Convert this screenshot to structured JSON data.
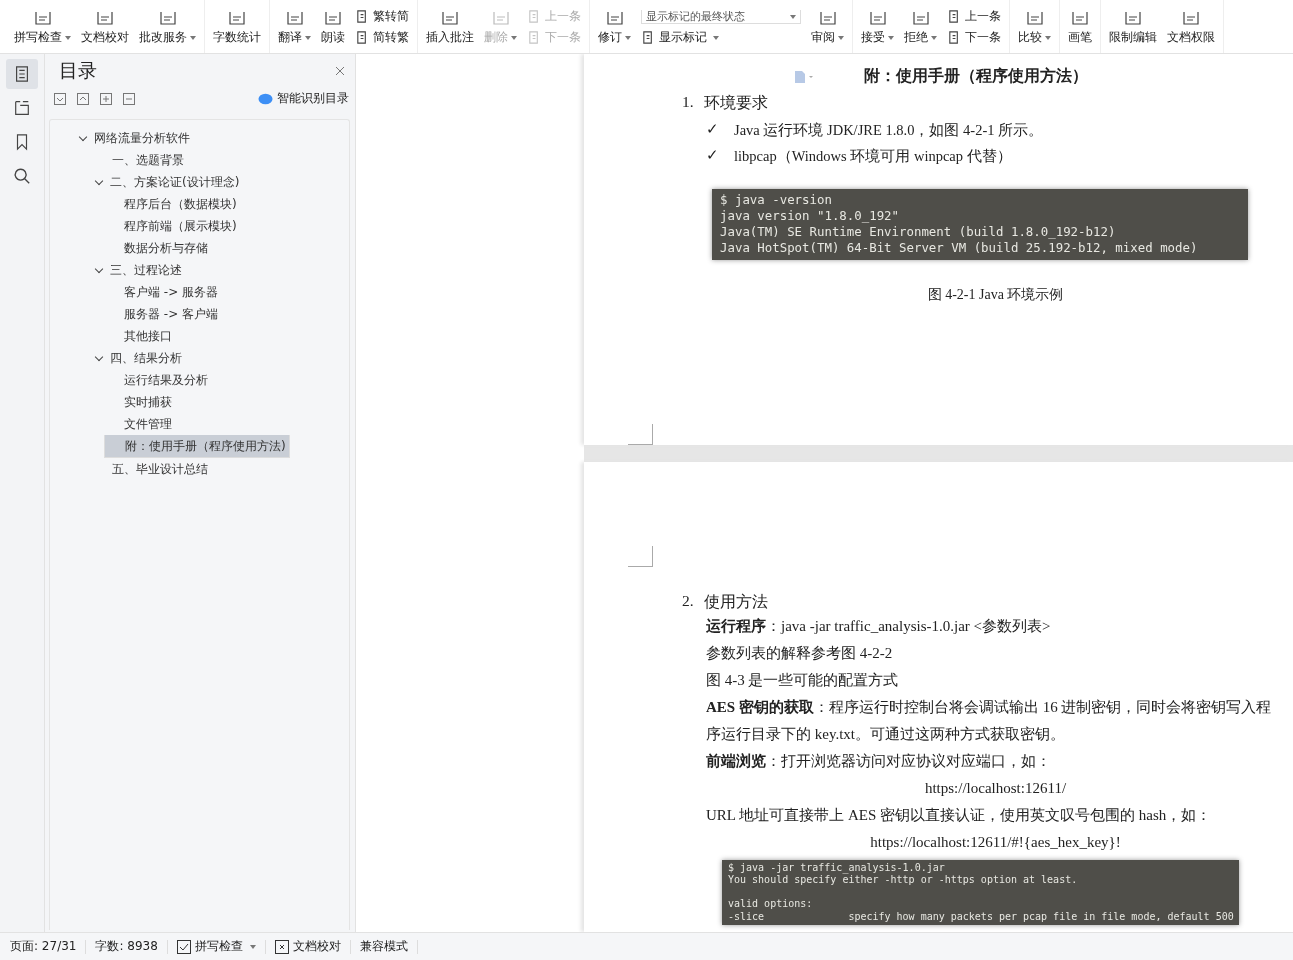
{
  "toolbar": {
    "groups": [
      {
        "items": [
          {
            "kind": "big",
            "label": "拼写检查",
            "dropdown": true,
            "disabled": false
          },
          {
            "kind": "big",
            "label": "文档校对",
            "dropdown": false,
            "disabled": false
          },
          {
            "kind": "big",
            "label": "批改服务",
            "dropdown": true,
            "disabled": false
          }
        ]
      },
      {
        "items": [
          {
            "kind": "big",
            "label": "字数统计",
            "dropdown": false,
            "disabled": false
          }
        ]
      },
      {
        "items": [
          {
            "kind": "big",
            "label": "翻译",
            "dropdown": true,
            "disabled": false
          },
          {
            "kind": "big",
            "label": "朗读",
            "dropdown": false,
            "disabled": false
          },
          {
            "kind": "stack",
            "items": [
              {
                "kind": "small",
                "label": "繁转简",
                "dropdown": false,
                "disabled": false
              },
              {
                "kind": "small",
                "label": "简转繁",
                "dropdown": false,
                "disabled": false
              }
            ]
          }
        ]
      },
      {
        "items": [
          {
            "kind": "big",
            "label": "插入批注",
            "dropdown": false,
            "disabled": false
          },
          {
            "kind": "big",
            "label": "删除",
            "dropdown": true,
            "disabled": true
          },
          {
            "kind": "stack",
            "items": [
              {
                "kind": "small",
                "label": "上一条",
                "dropdown": false,
                "disabled": true
              },
              {
                "kind": "small",
                "label": "下一条",
                "dropdown": false,
                "disabled": true
              }
            ]
          }
        ]
      },
      {
        "items": [
          {
            "kind": "big",
            "label": "修订",
            "dropdown": true,
            "disabled": false
          },
          {
            "kind": "stack",
            "items": [
              {
                "kind": "select",
                "label": "显示标记的最终状态"
              },
              {
                "kind": "small",
                "label": "显示标记",
                "dropdown": true,
                "disabled": false
              }
            ]
          },
          {
            "kind": "big",
            "label": "审阅",
            "dropdown": true,
            "disabled": false
          }
        ]
      },
      {
        "items": [
          {
            "kind": "big",
            "label": "接受",
            "dropdown": true,
            "disabled": false
          },
          {
            "kind": "big",
            "label": "拒绝",
            "dropdown": true,
            "disabled": false
          },
          {
            "kind": "stack",
            "items": [
              {
                "kind": "small",
                "label": "上一条",
                "dropdown": false,
                "disabled": false
              },
              {
                "kind": "small",
                "label": "下一条",
                "dropdown": false,
                "disabled": false
              }
            ]
          }
        ]
      },
      {
        "items": [
          {
            "kind": "big",
            "label": "比较",
            "dropdown": true,
            "disabled": false
          }
        ]
      },
      {
        "items": [
          {
            "kind": "big",
            "label": "画笔",
            "dropdown": false,
            "disabled": false
          }
        ]
      },
      {
        "items": [
          {
            "kind": "big",
            "label": "限制编辑",
            "dropdown": false,
            "disabled": false
          },
          {
            "kind": "big",
            "label": "文档权限",
            "dropdown": false,
            "disabled": false
          }
        ]
      }
    ]
  },
  "rail": [
    {
      "selected": true
    },
    {
      "selected": false
    },
    {
      "selected": false
    },
    {
      "selected": false
    }
  ],
  "nav_panel": {
    "title": "目录",
    "smart_button": "智能识别目录",
    "tree": [
      {
        "label": "网络流量分析软件",
        "expanded": true,
        "selected": false,
        "children": [
          {
            "label": "一、选题背景",
            "selected": false
          },
          {
            "label": "二、方案论证(设计理念)",
            "expanded": true,
            "selected": false,
            "children": [
              {
                "label": "程序后台（数据模块)",
                "selected": false
              },
              {
                "label": "程序前端（展示模块)",
                "selected": false
              },
              {
                "label": "数据分析与存储",
                "selected": false
              }
            ]
          },
          {
            "label": "三、过程论述",
            "expanded": true,
            "selected": false,
            "children": [
              {
                "label": "客户端 -> 服务器",
                "selected": false
              },
              {
                "label": "服务器 -> 客户端",
                "selected": false
              },
              {
                "label": "其他接口",
                "selected": false
              }
            ]
          },
          {
            "label": "四、结果分析",
            "expanded": true,
            "selected": false,
            "children": [
              {
                "label": "运行结果及分析",
                "selected": false
              },
              {
                "label": "实时捕获",
                "selected": false
              },
              {
                "label": "文件管理",
                "selected": false
              },
              {
                "label": "附：使用手册（程序使用方法)",
                "selected": true
              }
            ]
          },
          {
            "label": "五、毕业设计总结",
            "selected": false
          }
        ]
      }
    ]
  },
  "document": {
    "page_1": {
      "heading": "附：使用手册（程序使用方法）",
      "section_number": "1.",
      "section_title": "环境要求",
      "checklist": [
        {
          "mark": "✓",
          "text": "Java 运行环境  JDK/JRE 1.8.0，如图  4-2-1 所示。"
        },
        {
          "mark": "✓",
          "text": "libpcap（Windows 环境可用  winpcap 代替）"
        }
      ],
      "console": [
        "$ java -version",
        "java version \"1.8.0_192\"",
        "Java(TM) SE Runtime Environment (build 1.8.0_192-b12)",
        "Java HotSpot(TM) 64-Bit Server VM (build 25.192-b12, mixed mode)"
      ],
      "caption": "图  4-2-1 Java 环境示例"
    },
    "page_2": {
      "section_number": "2.",
      "section_title": "使用方法",
      "blocks": [
        {
          "kind": "para",
          "text": "**运行程序**：java -jar traffic_analysis-1.0.jar <参数列表>"
        },
        {
          "kind": "para",
          "text": "参数列表的解释参考图  4-2-2"
        },
        {
          "kind": "para",
          "text": "图  4-3 是一些可能的配置方式"
        },
        {
          "kind": "para",
          "text": "**AES 密钥的获取**：程序运行时控制台将会调试输出  16 进制密钥，同时会将密钥写入程序运行目录下的  key.txt。可通过这两种方式获取密钥。"
        },
        {
          "kind": "para",
          "text": "**前端浏览**：打开浏览器访问对应协议对应端口，如："
        },
        {
          "kind": "link",
          "text": "https://localhost:12611/"
        },
        {
          "kind": "para",
          "text": "URL 地址可直接带上  AES 密钥以直接认证，使用英文叹号包围的  hash，如："
        },
        {
          "kind": "link",
          "text": "https://localhost:12611/#!{aes_hex_key}!"
        }
      ],
      "console": [
        [
          "$ java -jar traffic_analysis-1.0.jar",
          "You should specify either -http or -https option at least."
        ],
        [
          "valid options:",
          "-slice              specify how many packets per pcap file in file mode, default 500"
        ]
      ]
    }
  },
  "status_bar": {
    "page": "页面: 27/31",
    "words": "字数: 8938",
    "spell_check": "拼写检查",
    "proofread": "文档校对",
    "mode": "兼容模式"
  }
}
